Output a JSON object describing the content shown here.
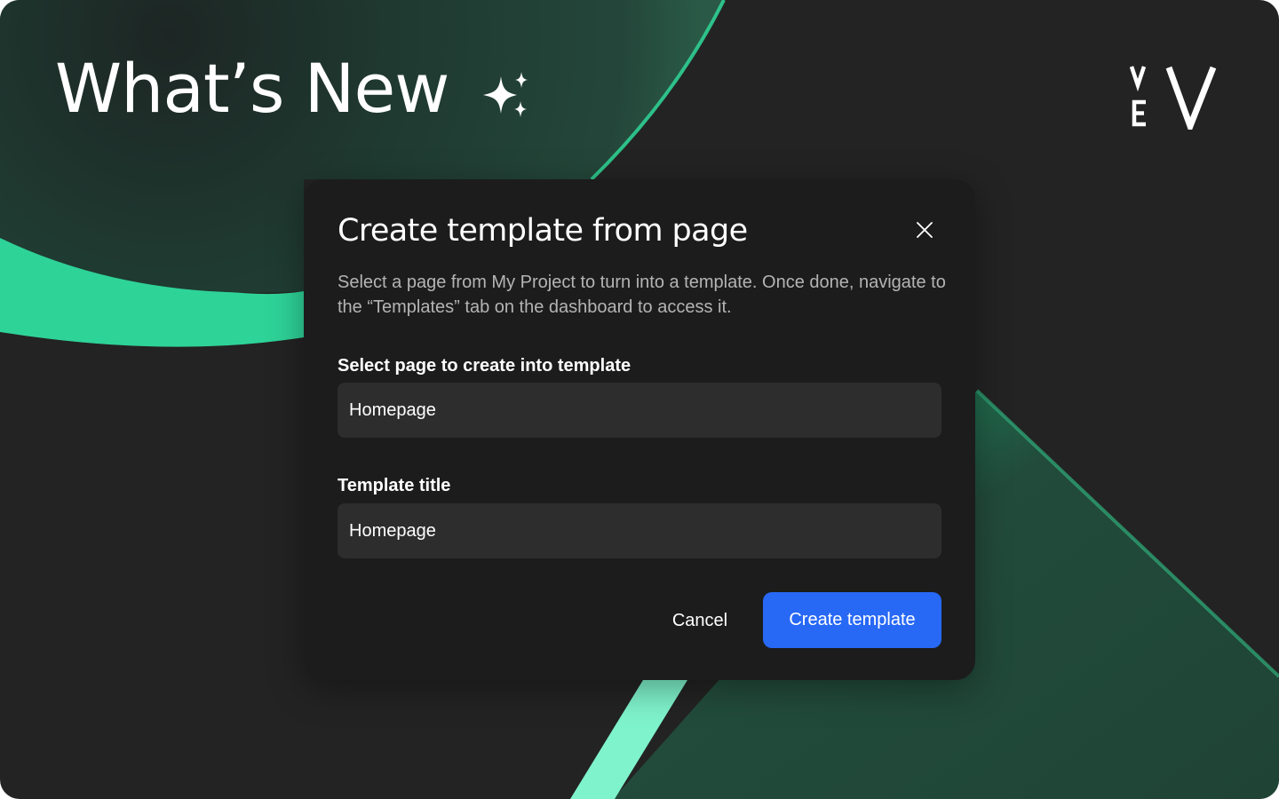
{
  "hero": {
    "title": "What’s New"
  },
  "icons": {
    "sparkle": "sparkle-icon",
    "logo": "ve-logo",
    "close": "close-icon"
  },
  "dialog": {
    "title": "Create template from page",
    "description": "Select a page from My Project to turn into a template. Once done, navigate to the “Templates” tab on the dashboard to access it.",
    "page_field": {
      "label": "Select page to create into template",
      "value": "Homepage"
    },
    "title_field": {
      "label": "Template title",
      "value": "Homepage"
    },
    "cancel_label": "Cancel",
    "create_label": "Create template"
  },
  "colors": {
    "background": "#232323",
    "dialog": "#1c1c1c",
    "field": "#2d2d2d",
    "accent": "#2768f5",
    "green": "#2ed398",
    "mint": "#7ff3cc",
    "dark_green": "#204637"
  }
}
